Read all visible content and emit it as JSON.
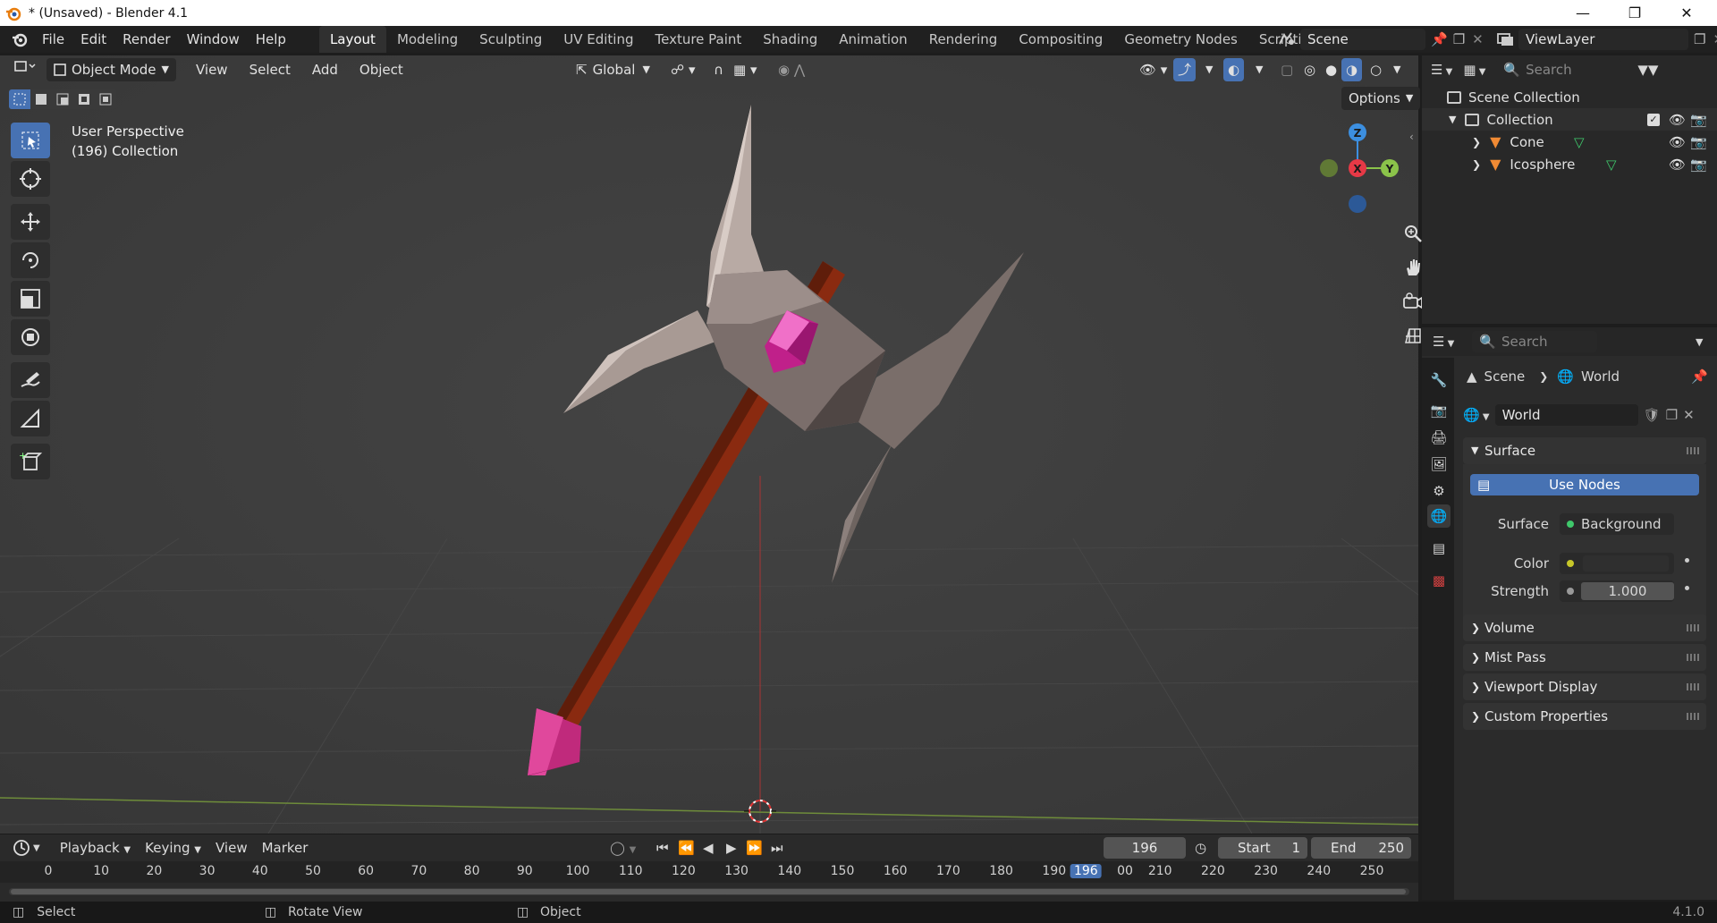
{
  "window": {
    "title": "* (Unsaved) - Blender 4.1"
  },
  "menu": [
    "File",
    "Edit",
    "Render",
    "Window",
    "Help"
  ],
  "workspaces": [
    "Layout",
    "Modeling",
    "Sculpting",
    "UV Editing",
    "Texture Paint",
    "Shading",
    "Animation",
    "Rendering",
    "Compositing",
    "Geometry Nodes",
    "Scripting"
  ],
  "active_workspace": "Layout",
  "scene": {
    "name": "Scene"
  },
  "view_layer": {
    "name": "ViewLayer"
  },
  "viewport": {
    "mode": "Object Mode",
    "menus": [
      "View",
      "Select",
      "Add",
      "Object"
    ],
    "transform_orientation": "Global",
    "options_label": "Options",
    "overlay_line1": "User Perspective",
    "overlay_line2": "(196) Collection",
    "gizmo": {
      "x": "X",
      "y": "Y",
      "z": "Z"
    }
  },
  "outliner": {
    "search_placeholder": "Search",
    "root": "Scene Collection",
    "collection": "Collection",
    "objects": [
      "Cone",
      "Icosphere"
    ]
  },
  "properties": {
    "search_placeholder": "Search",
    "breadcrumb": [
      "Scene",
      "World"
    ],
    "world_name": "World",
    "surface_panel": "Surface",
    "use_nodes_label": "Use Nodes",
    "surface_label": "Surface",
    "surface_value": "Background",
    "color_label": "Color",
    "strength_label": "Strength",
    "strength_value": "1.000",
    "panels": [
      "Volume",
      "Mist Pass",
      "Viewport Display",
      "Custom Properties"
    ]
  },
  "timeline": {
    "menus": [
      "Playback",
      "Keying",
      "View",
      "Marker"
    ],
    "current_frame": "196",
    "start_label": "Start",
    "start_value": "1",
    "end_label": "End",
    "end_value": "250",
    "ruler": [
      "0",
      "10",
      "20",
      "30",
      "40",
      "50",
      "60",
      "70",
      "80",
      "90",
      "100",
      "110",
      "120",
      "130",
      "140",
      "150",
      "160",
      "170",
      "180",
      "190",
      "196",
      "00",
      "210",
      "220",
      "230",
      "240",
      "250"
    ]
  },
  "status": {
    "left": "Select",
    "middle": "Rotate View",
    "right": "Object",
    "version": "4.1.0"
  },
  "colors": {
    "accent": "#4772b3",
    "viewport_bg": "#3d3d3d",
    "axis_x": "#e63946",
    "axis_y": "#8bc34a",
    "axis_z": "#3c8fe0",
    "gem": "#d6338c",
    "handle": "#8a2a10"
  }
}
